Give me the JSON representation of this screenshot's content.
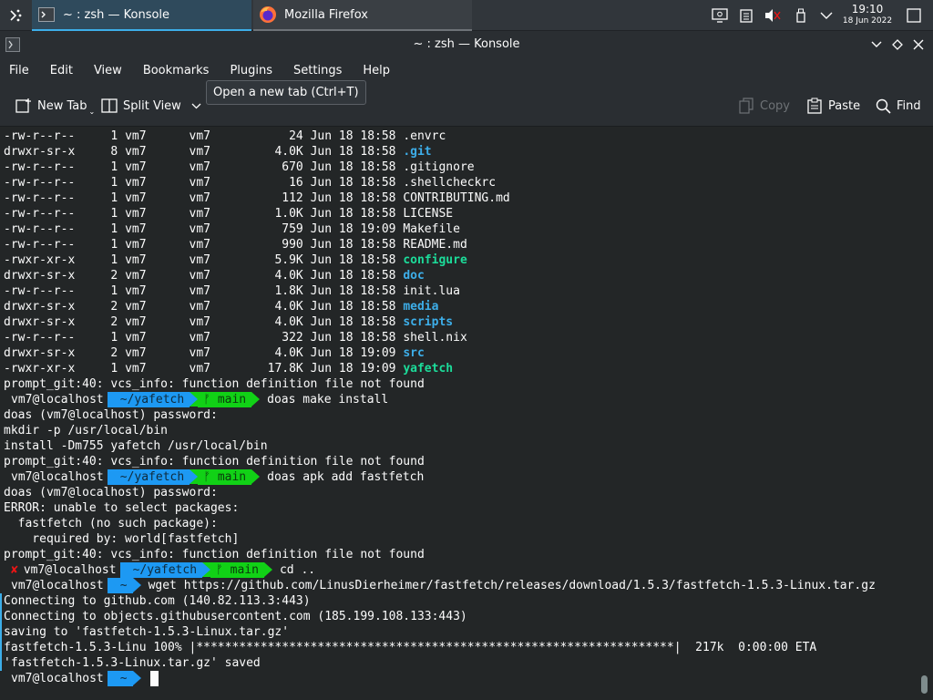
{
  "panel": {
    "tasks": [
      {
        "label": "~ : zsh — Konsole",
        "icon": "konsole-icon"
      },
      {
        "label": "Mozilla Firefox",
        "icon": "firefox-icon"
      }
    ],
    "clock": {
      "time": "19:10",
      "date": "18 Jun 2022"
    }
  },
  "window": {
    "title": "~ : zsh — Konsole"
  },
  "menubar": [
    "File",
    "Edit",
    "View",
    "Bookmarks",
    "Plugins",
    "Settings",
    "Help"
  ],
  "toolbar": {
    "new_tab": "New Tab",
    "split_view": "Split View",
    "copy": "Copy",
    "paste": "Paste",
    "find": "Find",
    "tooltip": "Open a new tab (Ctrl+T)"
  },
  "terminal": {
    "listing": [
      {
        "perm": "-rw-r--r--",
        "links": "1",
        "user": "vm7",
        "group": "vm7",
        "size": "24",
        "date": "Jun 18 18:58",
        "name": ".envrc",
        "kind": "file"
      },
      {
        "perm": "drwxr-sr-x",
        "links": "8",
        "user": "vm7",
        "group": "vm7",
        "size": "4.0K",
        "date": "Jun 18 18:58",
        "name": ".git",
        "kind": "dir"
      },
      {
        "perm": "-rw-r--r--",
        "links": "1",
        "user": "vm7",
        "group": "vm7",
        "size": "670",
        "date": "Jun 18 18:58",
        "name": ".gitignore",
        "kind": "file"
      },
      {
        "perm": "-rw-r--r--",
        "links": "1",
        "user": "vm7",
        "group": "vm7",
        "size": "16",
        "date": "Jun 18 18:58",
        "name": ".shellcheckrc",
        "kind": "file"
      },
      {
        "perm": "-rw-r--r--",
        "links": "1",
        "user": "vm7",
        "group": "vm7",
        "size": "112",
        "date": "Jun 18 18:58",
        "name": "CONTRIBUTING.md",
        "kind": "file"
      },
      {
        "perm": "-rw-r--r--",
        "links": "1",
        "user": "vm7",
        "group": "vm7",
        "size": "1.0K",
        "date": "Jun 18 18:58",
        "name": "LICENSE",
        "kind": "file"
      },
      {
        "perm": "-rw-r--r--",
        "links": "1",
        "user": "vm7",
        "group": "vm7",
        "size": "759",
        "date": "Jun 18 19:09",
        "name": "Makefile",
        "kind": "file"
      },
      {
        "perm": "-rw-r--r--",
        "links": "1",
        "user": "vm7",
        "group": "vm7",
        "size": "990",
        "date": "Jun 18 18:58",
        "name": "README.md",
        "kind": "file"
      },
      {
        "perm": "-rwxr-xr-x",
        "links": "1",
        "user": "vm7",
        "group": "vm7",
        "size": "5.9K",
        "date": "Jun 18 18:58",
        "name": "configure",
        "kind": "exec"
      },
      {
        "perm": "drwxr-sr-x",
        "links": "2",
        "user": "vm7",
        "group": "vm7",
        "size": "4.0K",
        "date": "Jun 18 18:58",
        "name": "doc",
        "kind": "dir"
      },
      {
        "perm": "-rw-r--r--",
        "links": "1",
        "user": "vm7",
        "group": "vm7",
        "size": "1.8K",
        "date": "Jun 18 18:58",
        "name": "init.lua",
        "kind": "file"
      },
      {
        "perm": "drwxr-sr-x",
        "links": "2",
        "user": "vm7",
        "group": "vm7",
        "size": "4.0K",
        "date": "Jun 18 18:58",
        "name": "media",
        "kind": "dir"
      },
      {
        "perm": "drwxr-sr-x",
        "links": "2",
        "user": "vm7",
        "group": "vm7",
        "size": "4.0K",
        "date": "Jun 18 18:58",
        "name": "scripts",
        "kind": "dir"
      },
      {
        "perm": "-rw-r--r--",
        "links": "1",
        "user": "vm7",
        "group": "vm7",
        "size": "322",
        "date": "Jun 18 18:58",
        "name": "shell.nix",
        "kind": "file"
      },
      {
        "perm": "drwxr-sr-x",
        "links": "2",
        "user": "vm7",
        "group": "vm7",
        "size": "4.0K",
        "date": "Jun 18 19:09",
        "name": "src",
        "kind": "dir"
      },
      {
        "perm": "-rwxr-xr-x",
        "links": "1",
        "user": "vm7",
        "group": "vm7",
        "size": "17.8K",
        "date": "Jun 18 19:09",
        "name": "yafetch",
        "kind": "exec"
      }
    ],
    "output": [
      "prompt_git:40: vcs_info: function definition file not found",
      "doas (vm7@localhost) password:",
      "mkdir -p /usr/local/bin",
      "install -Dm755 yafetch /usr/local/bin",
      "prompt_git:40: vcs_info: function definition file not found",
      "doas (vm7@localhost) password:",
      "ERROR: unable to select packages:",
      "  fastfetch (no such package):",
      "    required by: world[fastfetch]",
      "prompt_git:40: vcs_info: function definition file not found",
      "Connecting to github.com (140.82.113.3:443)",
      "Connecting to objects.githubusercontent.com (185.199.108.133:443)",
      "saving to 'fastfetch-1.5.3-Linux.tar.gz'",
      "fastfetch-1.5.3-Linu 100% |*******************************************************************|  217k  0:00:00 ETA",
      "'fastfetch-1.5.3-Linux.tar.gz' saved"
    ],
    "prompts": [
      {
        "host": "vm7@localhost",
        "dir": "~/yafetch",
        "git": "ᚠ main",
        "cmd": "doas make install",
        "error": false
      },
      {
        "host": "vm7@localhost",
        "dir": "~/yafetch",
        "git": "ᚠ main",
        "cmd": "doas apk add fastfetch",
        "error": false
      },
      {
        "host": "vm7@localhost",
        "dir": "~/yafetch",
        "git": "ᚠ main",
        "cmd": "cd ..",
        "error": true,
        "error_mark": "✘"
      },
      {
        "host": "vm7@localhost",
        "dir": "~",
        "git": "",
        "cmd": "wget https://github.com/LinusDierheimer/fastfetch/releases/download/1.5.3/fastfetch-1.5.3-Linux.tar.gz",
        "error": false
      },
      {
        "host": "vm7@localhost",
        "dir": "~",
        "git": "",
        "cmd": "",
        "error": false
      }
    ]
  },
  "colors": {
    "dir": "#3daee9",
    "exec": "#1cdc9a",
    "prompt_dir_bg": "#1d99f3",
    "prompt_git_bg": "#11d116",
    "error": "#ed1515"
  }
}
